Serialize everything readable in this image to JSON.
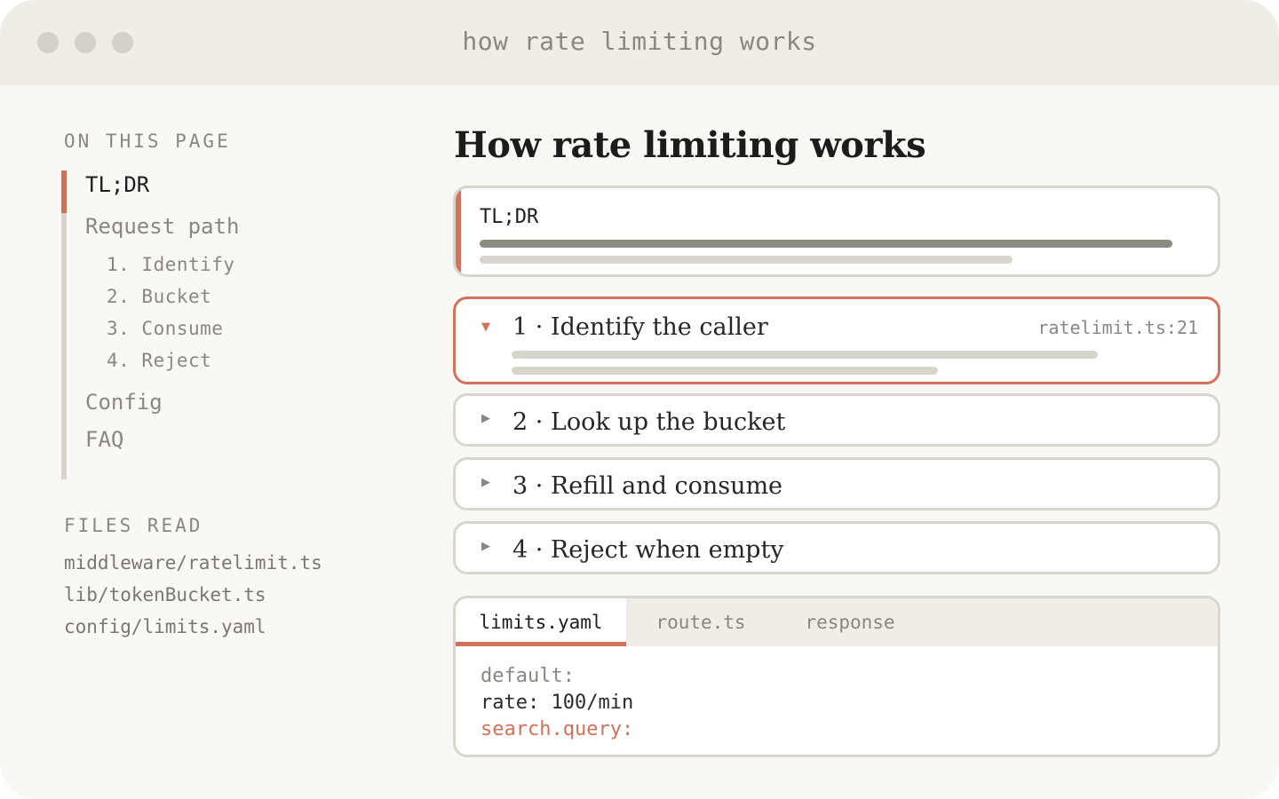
{
  "window": {
    "title": "how rate limiting works"
  },
  "sidebar": {
    "on_this_page_label": "ON THIS PAGE",
    "toc": [
      {
        "label": "TL;DR",
        "active": true
      },
      {
        "label": "Request path"
      },
      {
        "label": "Config"
      },
      {
        "label": "FAQ"
      }
    ],
    "subitems": [
      "1. Identify",
      "2. Bucket",
      "3. Consume",
      "4. Reject"
    ],
    "files_label": "FILES READ",
    "files": [
      "middleware/ratelimit.ts",
      "lib/tokenBucket.ts",
      "config/limits.yaml"
    ]
  },
  "main": {
    "title": "How rate limiting works",
    "tldr": {
      "label": "TL;DR"
    },
    "steps": [
      {
        "title": "1 · Identify the caller",
        "ref": "ratelimit.ts:21",
        "expanded": true,
        "arrow": "▼"
      },
      {
        "title": "2 · Look up the bucket",
        "expanded": false,
        "arrow": "▶"
      },
      {
        "title": "3 · Refill and consume",
        "expanded": false,
        "arrow": "▶"
      },
      {
        "title": "4 · Reject when empty",
        "expanded": false,
        "arrow": "▶"
      }
    ],
    "code": {
      "tabs": [
        {
          "label": "limits.yaml",
          "active": true
        },
        {
          "label": "route.ts"
        },
        {
          "label": "response"
        }
      ],
      "lines": [
        "default:",
        "rate: 100/min",
        "search.query:"
      ]
    }
  },
  "colors": {
    "accent": "#d4715a",
    "muted": "#8a8780",
    "rail": "#d7d4cb",
    "bar_dark": "#898c7e"
  }
}
